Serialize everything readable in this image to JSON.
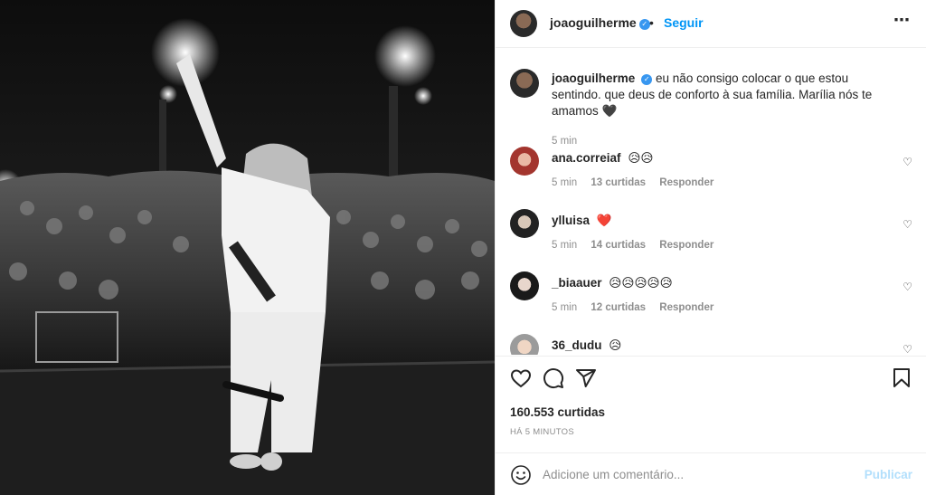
{
  "header": {
    "username": "joaoguilherme",
    "separator": "•",
    "follow_label": "Seguir",
    "more_icon": "more-horizontal-icon"
  },
  "caption": {
    "username": "joaoguilherme",
    "text": "eu não consigo colocar o que estou sentindo. que deus de conforto à sua família. Marília nós te amamos 🖤",
    "time": "5 min"
  },
  "comments": [
    {
      "username": "ana.correiaf",
      "text": "😥😥",
      "time": "5 min",
      "likes": "13 curtidas",
      "reply": "Responder"
    },
    {
      "username": "ylluisa",
      "text": "❤️",
      "time": "5 min",
      "likes": "14 curtidas",
      "reply": "Responder"
    },
    {
      "username": "_biaauer",
      "text": "😥😥😥😥😥",
      "time": "5 min",
      "likes": "12 curtidas",
      "reply": "Responder"
    },
    {
      "username": "36_dudu",
      "text": "😥",
      "time": "",
      "likes": "",
      "reply": ""
    }
  ],
  "actions": {
    "likes_count": "160.553 curtidas",
    "time_ago": "HÁ 5 MINUTOS"
  },
  "compose": {
    "placeholder": "Adicione um comentário...",
    "publish_label": "Publicar"
  },
  "colors": {
    "accent": "#0095f6",
    "verified": "#3897f0",
    "muted": "#8e8e8e",
    "publish_disabled": "#b2dffc"
  }
}
